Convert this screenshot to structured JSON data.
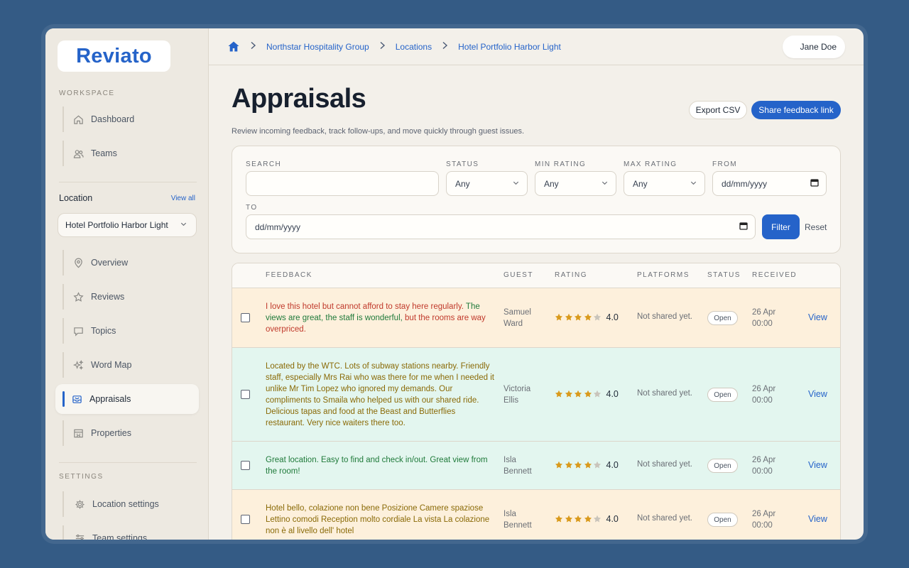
{
  "app": {
    "logo": "Reviato"
  },
  "sidebar": {
    "workspace_label": "WORKSPACE",
    "workspace_items": [
      {
        "label": "Dashboard",
        "icon": "home-icon"
      },
      {
        "label": "Teams",
        "icon": "users-icon"
      }
    ],
    "location_title": "Location",
    "view_all": "View all",
    "location_select": "Hotel Portfolio Harbor Light",
    "location_items": [
      {
        "label": "Overview",
        "icon": "map-pin-icon"
      },
      {
        "label": "Reviews",
        "icon": "star-icon"
      },
      {
        "label": "Topics",
        "icon": "chat-icon"
      },
      {
        "label": "Word Map",
        "icon": "sparkles-icon"
      },
      {
        "label": "Appraisals",
        "icon": "inbox-icon",
        "active": true
      },
      {
        "label": "Properties",
        "icon": "building-icon"
      }
    ],
    "settings_label": "SETTINGS",
    "settings_items": [
      {
        "label": "Location settings",
        "icon": "gear-icon"
      },
      {
        "label": "Team settings",
        "icon": "sliders-icon"
      }
    ]
  },
  "breadcrumb": [
    "Northstar Hospitality Group",
    "Locations",
    "Hotel Portfolio Harbor Light"
  ],
  "user": {
    "name": "Jane Doe"
  },
  "page": {
    "title": "Appraisals",
    "subtitle": "Review incoming feedback, track follow-ups, and move quickly through guest issues.",
    "export_label": "Export CSV",
    "share_label": "Share feedback link"
  },
  "filters": {
    "search_label": "SEARCH",
    "search_value": "",
    "status_label": "STATUS",
    "status_value": "Any",
    "min_rating_label": "MIN RATING",
    "min_rating_value": "Any",
    "max_rating_label": "MAX RATING",
    "max_rating_value": "Any",
    "from_label": "FROM",
    "from_placeholder": "dd/mm/yyyy",
    "to_label": "TO",
    "to_placeholder": "dd/mm/yyyy",
    "filter_label": "Filter",
    "reset_label": "Reset"
  },
  "table": {
    "columns": [
      "FEEDBACK",
      "GUEST",
      "RATING",
      "PLATFORMS",
      "STATUS",
      "RECEIVED"
    ],
    "view_label": "View",
    "rows": [
      {
        "feedback_segments": [
          {
            "text": "I love this hotel but cannot afford to stay here regularly.",
            "tone": "red"
          },
          {
            "text": " The views are great, the staff is wonderful,",
            "tone": "green"
          },
          {
            "text": " but the rooms are way overpriced.",
            "tone": "red"
          }
        ],
        "guest": "Samuel Ward",
        "rating": 4,
        "rating_text": "4.0",
        "platforms": "Not shared yet.",
        "status": "Open",
        "received": "26 Apr 00:00",
        "tint": "amber"
      },
      {
        "feedback_segments": [
          {
            "text": "Located by the WTC. Lots of subway stations nearby.",
            "tone": "amber"
          },
          {
            "text": " Friendly staff, especially Mrs Rai who was there for me when I needed it",
            "tone": "amber"
          },
          {
            "text": " unlike Mr Tim Lopez who ignored my demands.",
            "tone": "amber"
          },
          {
            "text": " Our compliments to Smaila who helped us with our shared ride. Delicious tapas and food at the Beast and Butterflies restaurant. Very nice waiters there too.",
            "tone": "amber"
          }
        ],
        "guest": "Victoria Ellis",
        "rating": 4,
        "rating_text": "4.0",
        "platforms": "Not shared yet.",
        "status": "Open",
        "received": "26 Apr 00:00",
        "tint": "mint"
      },
      {
        "feedback_segments": [
          {
            "text": "Great location. Easy to find and check in/out. Great view from the room!",
            "tone": "green"
          }
        ],
        "guest": "Isla Bennett",
        "rating": 4,
        "rating_text": "4.0",
        "platforms": "Not shared yet.",
        "status": "Open",
        "received": "26 Apr 00:00",
        "tint": "mint"
      },
      {
        "feedback_segments": [
          {
            "text": "Hotel bello, colazione non bene Posizione Camere spaziose Lettino comodi Reception molto cordiale La vista La colazione non è al livello dell' hotel",
            "tone": "amber"
          }
        ],
        "guest": "Isla Bennett",
        "rating": 4,
        "rating_text": "4.0",
        "platforms": "Not shared yet.",
        "status": "Open",
        "received": "26 Apr 00:00",
        "tint": "amber"
      }
    ]
  },
  "colors": {
    "accent": "#2563c9",
    "star": "#d99a1c",
    "star_empty": "#c9c4bb"
  }
}
